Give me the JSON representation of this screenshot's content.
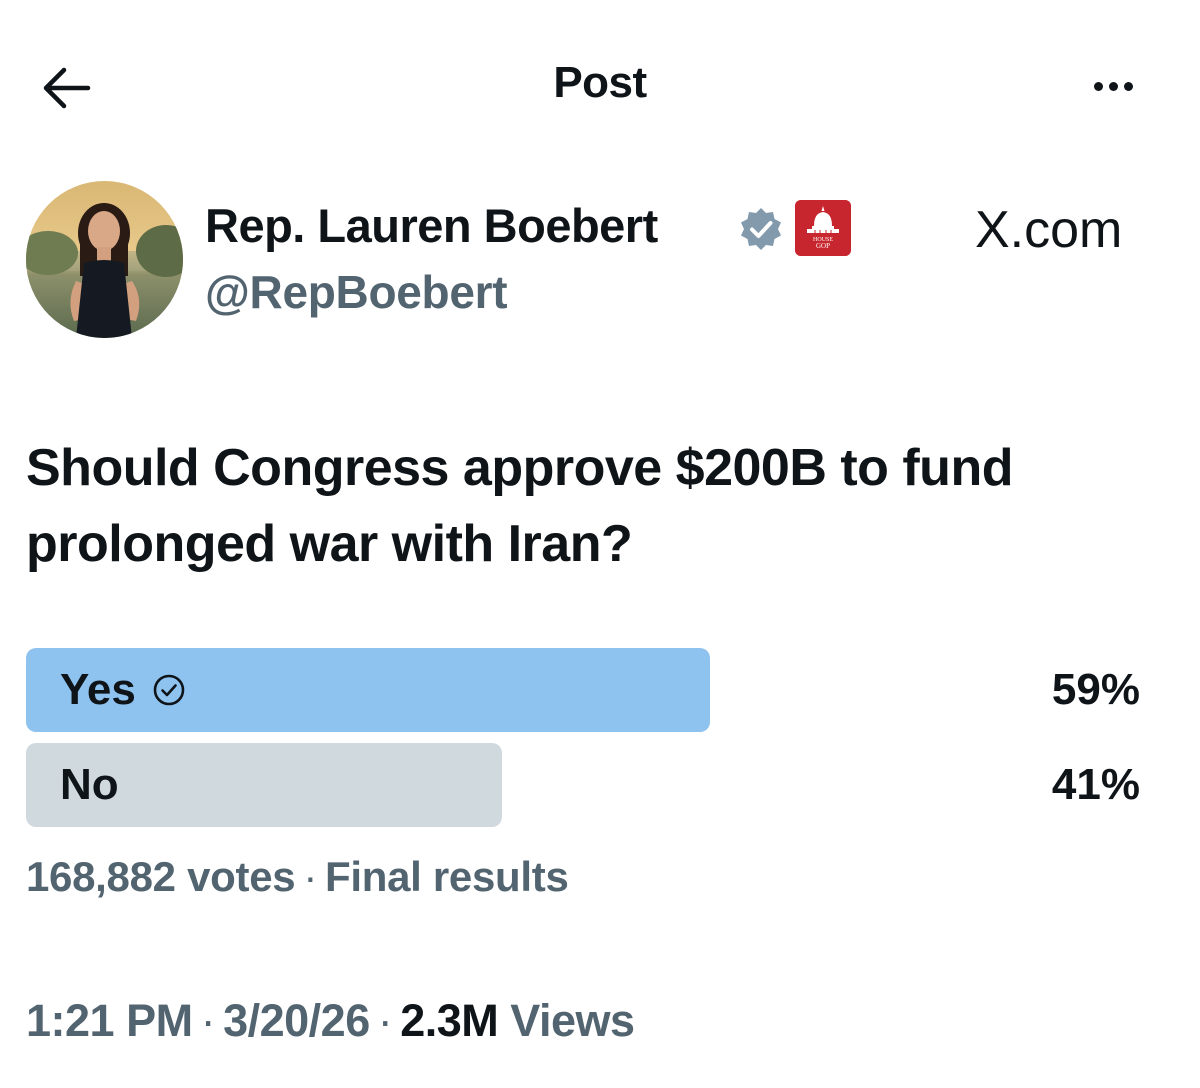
{
  "header": {
    "title": "Post",
    "back_icon": "arrow-left-icon",
    "more_icon": "more-horizontal-icon"
  },
  "author": {
    "display_name": "Rep. Lauren Boebert",
    "handle": "@RepBoebert",
    "verified_icon": "verified-badge-icon",
    "verified_color": "#829aab",
    "affiliation_badge": "house-gop-badge",
    "affiliation_badge_text": [
      "HOUSE",
      "GOP"
    ]
  },
  "watermark": "X.com",
  "tweet": {
    "question": "Should Congress approve $200B to fund prolonged war with Iran?"
  },
  "poll": {
    "options": [
      {
        "label": "Yes",
        "percent": "59%",
        "share": 0.59,
        "winner": true,
        "bar_color": "#8ec3f0"
      },
      {
        "label": "No",
        "percent": "41%",
        "share": 0.41,
        "winner": false,
        "bar_color": "#cfd9de"
      }
    ],
    "votes": "168,882 votes",
    "status": "Final results",
    "separator": "·"
  },
  "meta": {
    "time": "1:21 PM",
    "date": "3/20/26",
    "views_count": "2.3M",
    "views_label": "Views",
    "separator": "·"
  },
  "colors": {
    "text_primary": "#0f1419",
    "text_secondary": "#536471",
    "badge_red": "#c8262e"
  }
}
